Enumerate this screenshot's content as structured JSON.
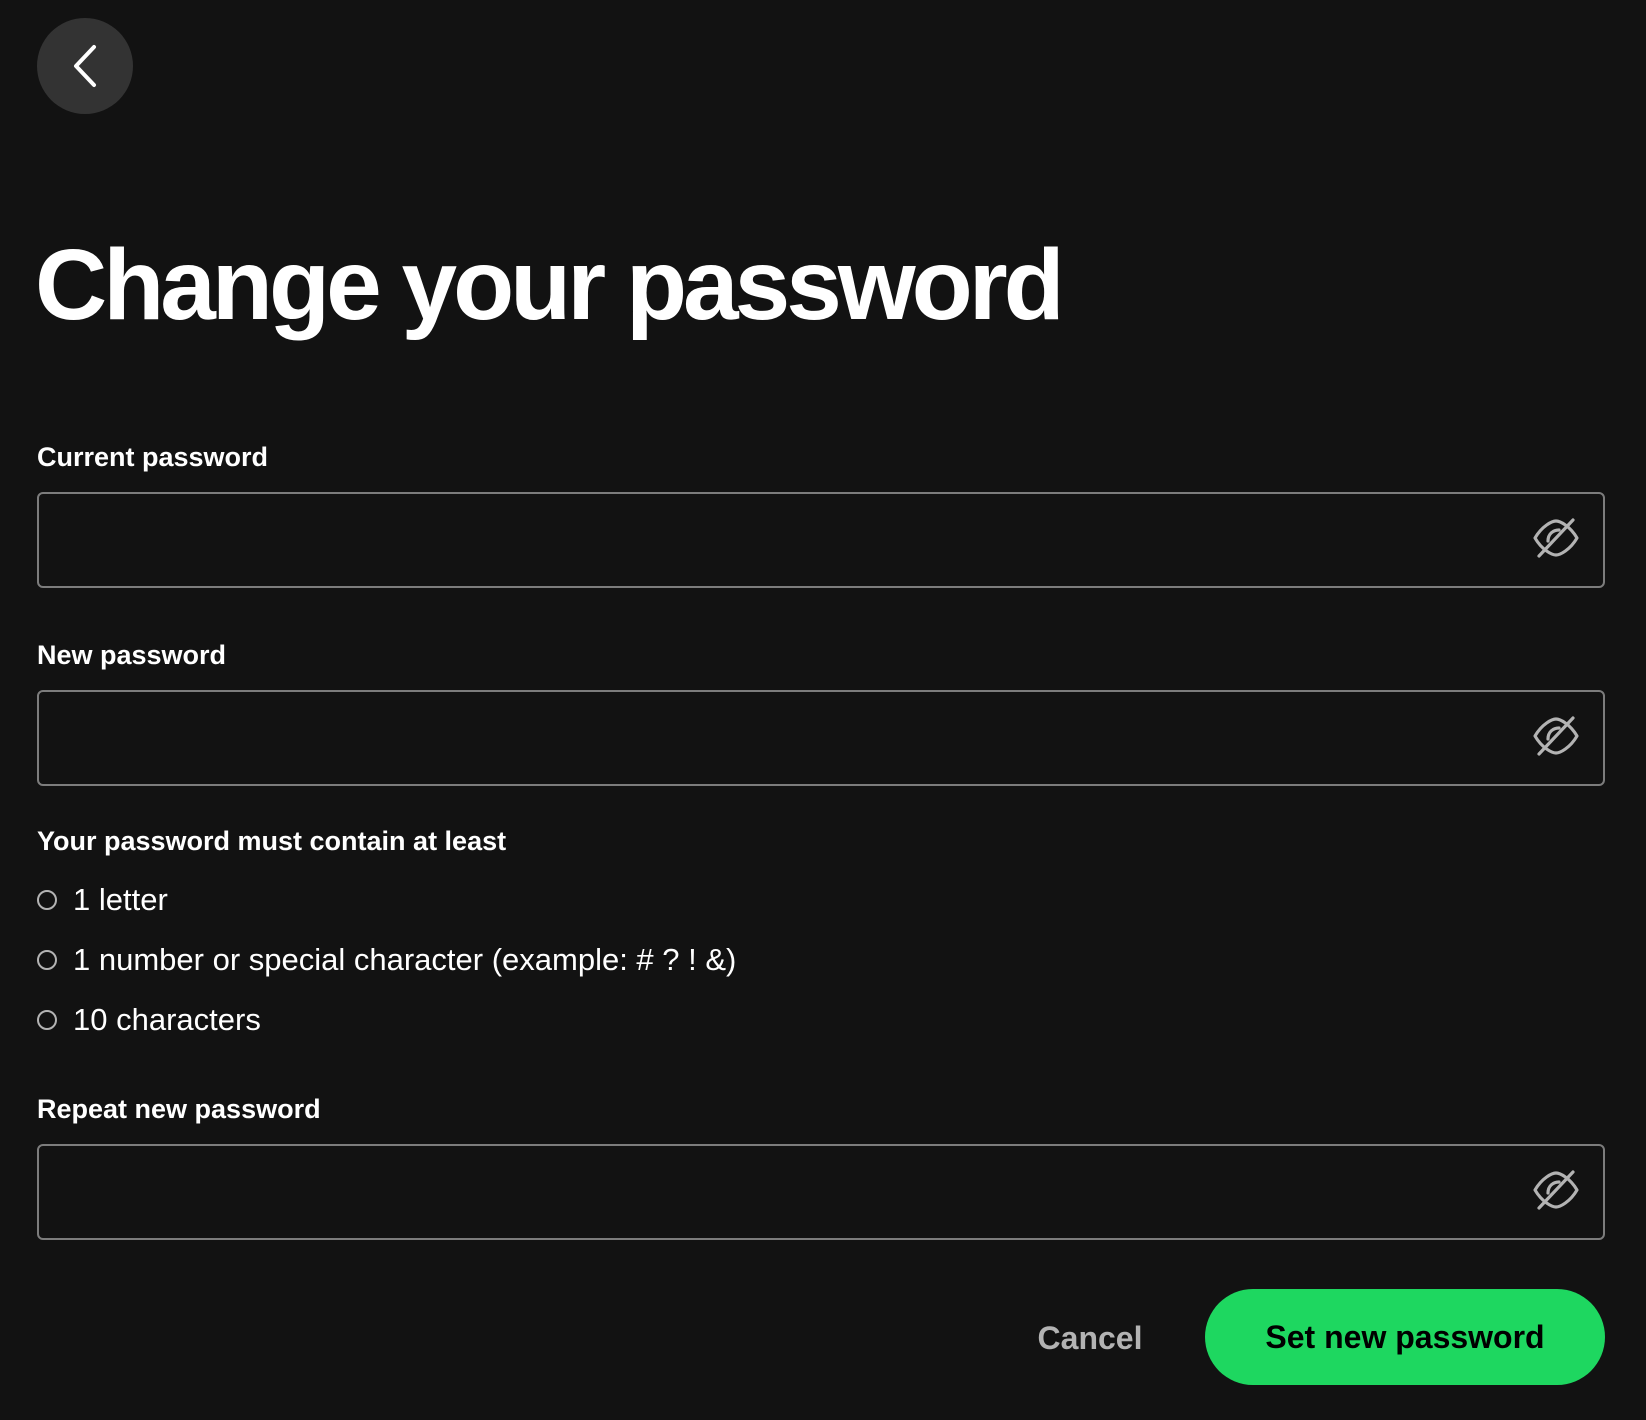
{
  "header": {
    "back_icon": "chevron-left-icon",
    "title": "Change your password"
  },
  "form": {
    "current_password": {
      "label": "Current password",
      "value": "",
      "placeholder": "",
      "toggle_icon": "eye-off-icon"
    },
    "new_password": {
      "label": "New password",
      "value": "",
      "placeholder": "",
      "toggle_icon": "eye-off-icon"
    },
    "requirements": {
      "title": "Your password must contain at least",
      "items": [
        {
          "text": "1 letter",
          "met": false
        },
        {
          "text": "1 number or special character (example: # ? ! &)",
          "met": false
        },
        {
          "text": "10 characters",
          "met": false
        }
      ]
    },
    "repeat_password": {
      "label": "Repeat new password",
      "value": "",
      "placeholder": "",
      "toggle_icon": "eye-off-icon"
    }
  },
  "actions": {
    "cancel_label": "Cancel",
    "submit_label": "Set new password"
  },
  "colors": {
    "background": "#121212",
    "accent": "#1ed760",
    "field_border": "#7c7c7c",
    "muted_text": "#b3b3b3",
    "back_button_bg": "#333333"
  }
}
